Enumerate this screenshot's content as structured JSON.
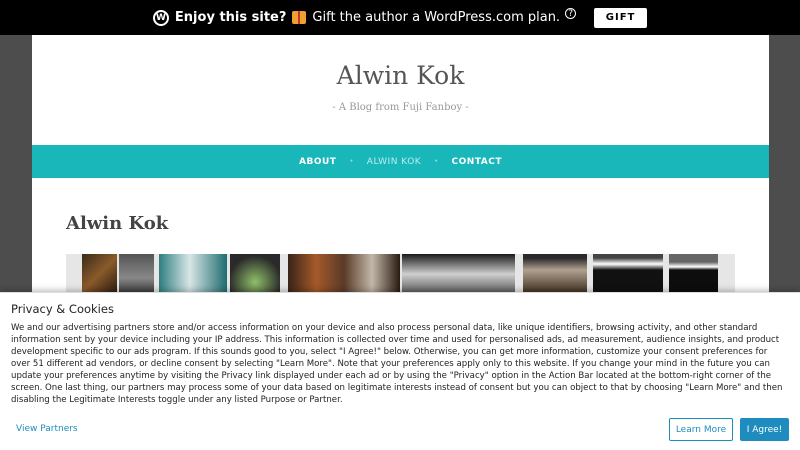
{
  "promo": {
    "bold_text": "Enjoy this site?",
    "text": "Gift the author a WordPress.com plan.",
    "help": "?",
    "gift_button": "GIFT",
    "wp_icon": "W"
  },
  "site": {
    "title": "Alwin Kok",
    "tagline": "- A Blog from Fuji Fanboy -"
  },
  "nav": {
    "items": [
      {
        "label": "ABOUT"
      },
      {
        "label": "ALWIN KOK"
      },
      {
        "label": "CONTACT"
      }
    ],
    "separator": "•",
    "current_index": 1
  },
  "page": {
    "title": "Alwin Kok"
  },
  "gallery": {
    "photos": [
      "photo-1",
      "photo-2",
      "photo-3",
      "photo-4",
      "photo-5",
      "photo-6",
      "photo-7",
      "photo-8",
      "photo-9",
      "photo-10",
      "photo-11"
    ]
  },
  "cookie": {
    "title": "Privacy & Cookies",
    "body": "We and our advertising partners store and/or access information on your device and also process personal data, like unique identifiers, browsing activity, and other standard information sent by your device including your IP address. This information is collected over time and used for personalised ads, ad measurement, audience insights, and product development specific to our ads program. If this sounds good to you, select \"I Agree!\" below. Otherwise, you can get more information, customize your consent preferences for over 51 different ad vendors, or decline consent by selecting \"Learn More\". Note that your preferences apply only to this website. If you change your mind in the future you can update your preferences anytime by visiting the Privacy link displayed under each ad or by using the \"Privacy\" option in the Action Bar located at the bottom-right corner of the screen. One last thing, our partners may process some of your data based on legitimate interests instead of consent but you can object to that by choosing \"Learn More\" and then disabling the Legitimate Interests toggle under any listed Purpose or Partner.",
    "view_partners": "View Partners",
    "learn_more": "Learn More",
    "agree": "I Agree!"
  },
  "colors": {
    "nav_bg": "#1ab7ba",
    "link": "#1e8cbe",
    "background": "#4d4d4d"
  }
}
